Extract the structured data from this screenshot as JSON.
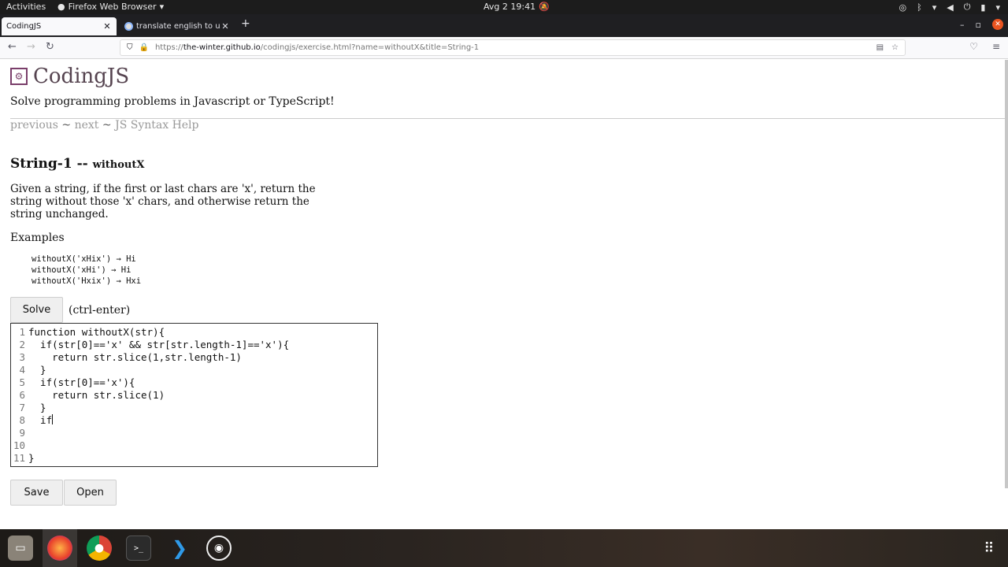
{
  "system_bar": {
    "activities": "Activities",
    "app_menu": "Firefox Web Browser",
    "clock": "Avg 2  19:41"
  },
  "browser": {
    "tabs": [
      {
        "title": "CodingJS",
        "active": true
      },
      {
        "title": "translate english to uzbek",
        "active": false
      }
    ],
    "url_prefix": "https://",
    "url_host": "the-winter.github.io",
    "url_path": "/codingjs/exercise.html?name=withoutX&title=String-1"
  },
  "page": {
    "site_title": "CodingJS",
    "tagline": "Solve programming problems in Javascript or TypeScript!",
    "nav": {
      "previous": "previous",
      "sep1": " ~ ",
      "next": "next",
      "sep2": " ~ ",
      "help": "JS Syntax Help"
    },
    "problem_group": "String-1 -- ",
    "problem_name": "withoutX",
    "description": "Given a string, if the first or last chars are 'x', return the string without those 'x' chars, and otherwise return the string unchanged.",
    "examples_label": "Examples",
    "examples": [
      "withoutX('xHix') → Hi",
      "withoutX('xHi') → Hi",
      "withoutX('Hxix') → Hxi"
    ],
    "solve_label": "Solve",
    "solve_hint": "(ctrl-enter)",
    "save_label": "Save",
    "open_label": "Open"
  },
  "editor": {
    "line_numbers": [
      "1",
      "2",
      "3",
      "4",
      "5",
      "6",
      "7",
      "8",
      "9",
      "10",
      "11"
    ],
    "lines": [
      "function withoutX(str){",
      "  if(str[0]=='x' && str[str.length-1]=='x'){",
      "    return str.slice(1,str.length-1)",
      "  }",
      "  if(str[0]=='x'){",
      "    return str.slice(1)",
      "  }",
      "  if",
      "",
      "",
      "}"
    ]
  },
  "colors": {
    "title_color": "#55434f",
    "logo_color": "#7a3e6a",
    "link_color": "#999999"
  }
}
